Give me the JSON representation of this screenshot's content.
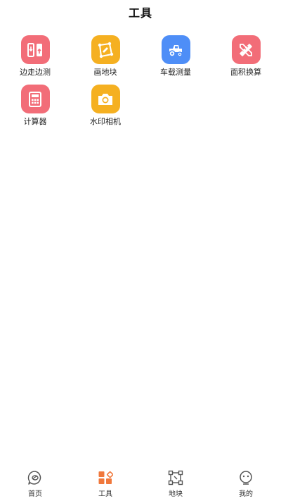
{
  "header": {
    "title": "工具"
  },
  "tools": [
    {
      "label": "边走边测",
      "icon": "walk-measure-icon",
      "color": "#F26D78"
    },
    {
      "label": "画地块",
      "icon": "draw-plot-icon",
      "color": "#F5B021"
    },
    {
      "label": "车载测量",
      "icon": "tractor-icon",
      "color": "#4E8EF7"
    },
    {
      "label": "面积换算",
      "icon": "ruler-pencil-icon",
      "color": "#F26D78"
    },
    {
      "label": "计算器",
      "icon": "calculator-icon",
      "color": "#F26D78"
    },
    {
      "label": "水印相机",
      "icon": "camera-icon",
      "color": "#F5B021"
    }
  ],
  "bottom_nav": {
    "items": [
      {
        "label": "首页",
        "icon": "home-icon"
      },
      {
        "label": "工具",
        "icon": "tools-icon",
        "active": true
      },
      {
        "label": "地块",
        "icon": "plot-icon"
      },
      {
        "label": "我的",
        "icon": "profile-icon"
      }
    ],
    "active_color": "#F0783C",
    "inactive_color": "#555555"
  }
}
